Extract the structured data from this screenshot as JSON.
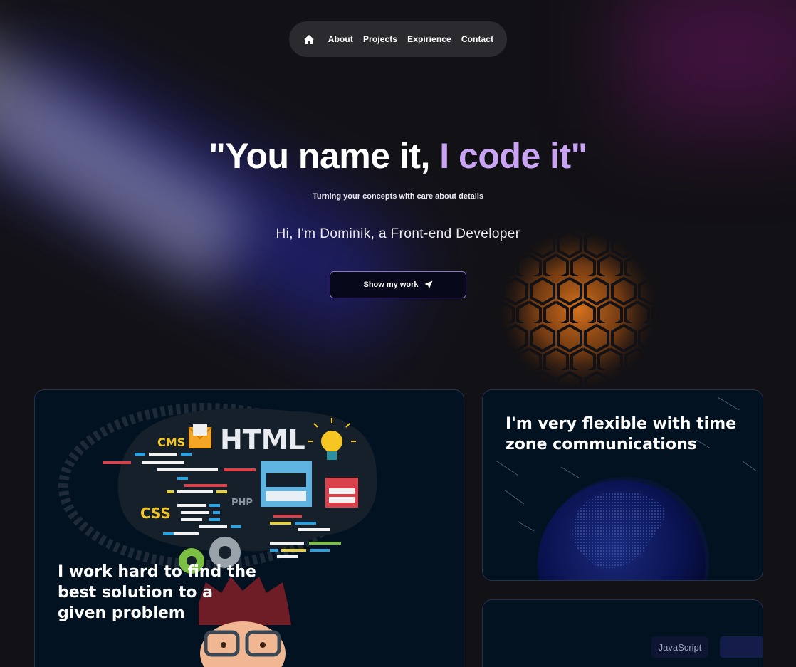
{
  "nav": {
    "items": [
      "About",
      "Projects",
      "Expirience",
      "Contact"
    ]
  },
  "hero": {
    "title_main": "\"You name it, ",
    "title_accent": "I code it\"",
    "subtitle": "Turning your concepts with care about details",
    "intro": "Hi, I'm Dominik, a Front-end Developer",
    "cta_label": "Show my work"
  },
  "cards": {
    "work": {
      "title": "I work hard to find the best solution to a given problem",
      "illustration_labels": {
        "html": "HTML",
        "cms": "CMS",
        "css": "CSS",
        "php": "PHP"
      }
    },
    "timezone": {
      "title": "I'm very flexible with time zone communications"
    },
    "stack": {
      "tags": [
        "JavaScript",
        ""
      ]
    }
  },
  "colors": {
    "background": "#121115",
    "accent_purple": "#c8a4f3",
    "card_bg": "#021220",
    "hex_orange": "#c06a1c"
  }
}
